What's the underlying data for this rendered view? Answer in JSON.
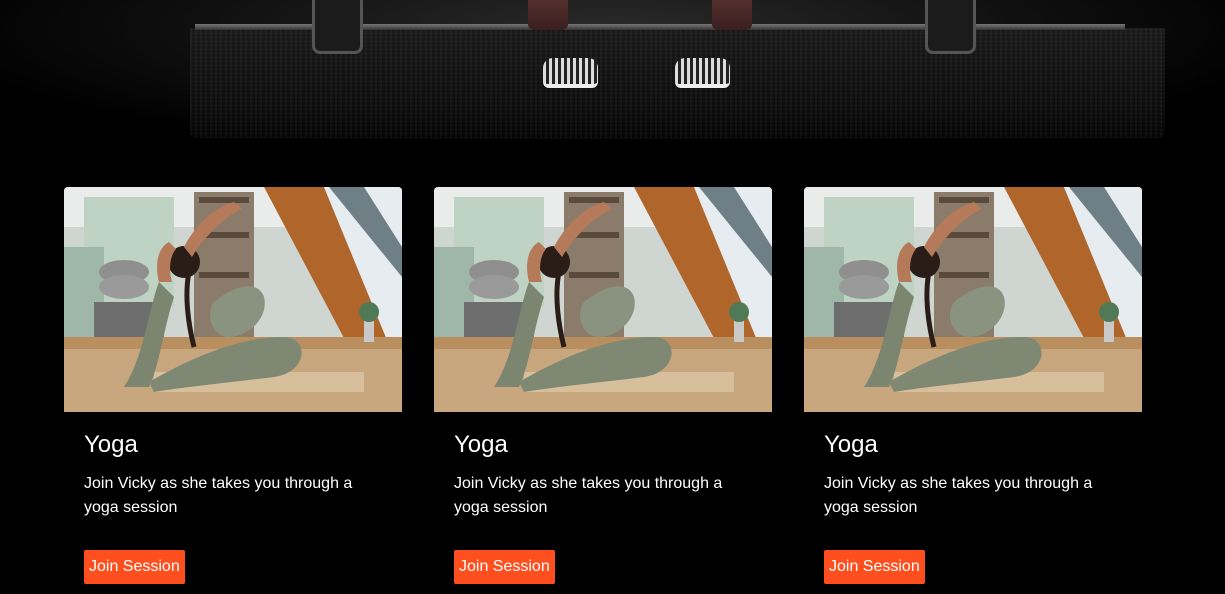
{
  "hero": {
    "image": "barbell-deadlift-photo"
  },
  "cards": [
    {
      "image": "yoga-pose-photo",
      "title": "Yoga",
      "description": "Join Vicky as she takes you through a yoga session",
      "button_label": "Join Session"
    },
    {
      "image": "yoga-pose-photo",
      "title": "Yoga",
      "description": "Join Vicky as she takes you through a yoga session",
      "button_label": "Join Session"
    },
    {
      "image": "yoga-pose-photo",
      "title": "Yoga",
      "description": "Join Vicky as she takes you through a yoga session",
      "button_label": "Join Session"
    }
  ],
  "colors": {
    "background": "#000000",
    "accent": "#ff4f1f",
    "text": "#ffffff"
  }
}
